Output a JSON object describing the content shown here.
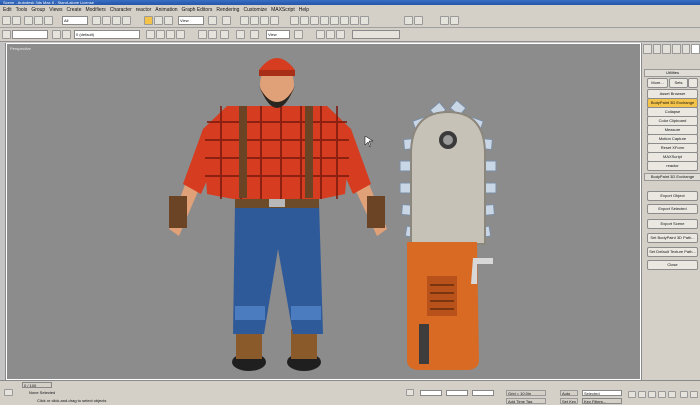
{
  "window": {
    "title": "Scene - Autodesk 3ds Max 8 - Stand-alone License"
  },
  "menu": [
    "Edit",
    "Tools",
    "Group",
    "Views",
    "Create",
    "Modifiers",
    "Character",
    "reactor",
    "Animation",
    "Graph Editors",
    "Rendering",
    "Customize",
    "MAXScript",
    "Help"
  ],
  "toolbar": {
    "selection_filter": "All",
    "reference_coord": "View",
    "layer": "0 (default)",
    "view_combo": "View"
  },
  "viewport": {
    "label": "Perspective"
  },
  "command_panel": {
    "utilities_title": "Utilities",
    "more_label": "More...",
    "sets_label": "Sets",
    "utility_buttons": [
      "Asset Browser",
      "BodyPaint 3D Exchange",
      "Collapse",
      "Color Clipboard",
      "Measure",
      "Motion Capture",
      "Reset XForm",
      "MAXScript",
      "reactor"
    ],
    "selected_utility": "BodyPaint 3D Exchange",
    "exchange_title": "BodyPaint 3D Exchange",
    "exchange_buttons": [
      "Export Object",
      "Export Selected",
      "Export Scene",
      "Set BodyPaint 3D Path...",
      "Set Default Texture Path..."
    ],
    "close_label": "Close"
  },
  "status": {
    "time_slider": "0 / 100",
    "selection": "None Selected",
    "prompt": "Click or click-and-drag to select objects",
    "grid": "Grid = 10.0in",
    "add_time_tag": "Add Time Tag",
    "auto_key": "Auto Key",
    "set_key": "Set Key",
    "key_filters": "Key Filters...",
    "selected_combo": "Selected"
  },
  "colors": {
    "viewport_bg": "#8c8c8c",
    "ui_bg": "#d4d0c8",
    "highlight": "#f3c34a"
  }
}
